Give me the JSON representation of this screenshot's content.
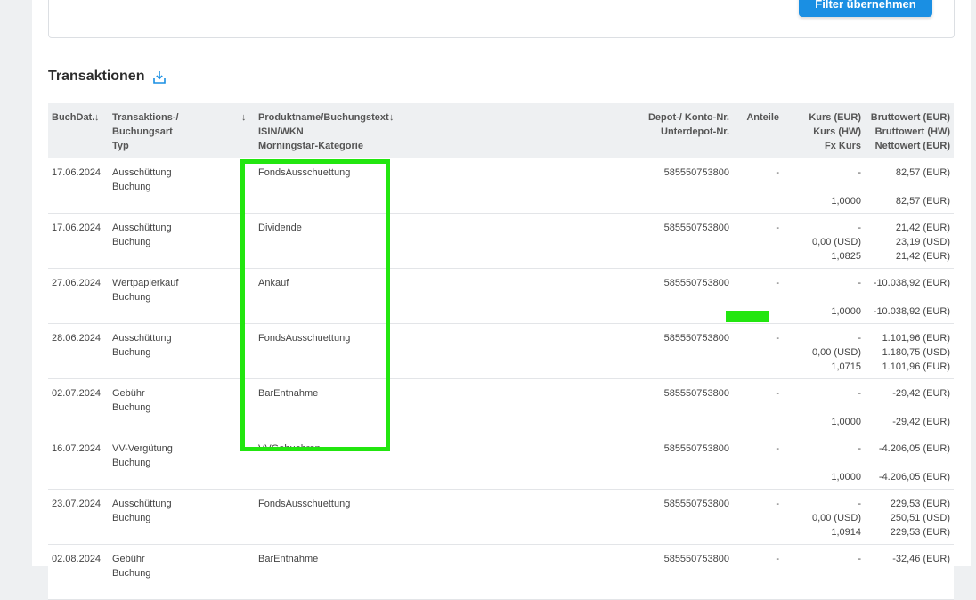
{
  "filter": {
    "apply_label": "Filter übernehmen"
  },
  "section": {
    "title": "Transaktionen",
    "download_icon": "download-icon"
  },
  "header": {
    "date": "BuchDat.",
    "type": [
      "Transaktions-/",
      "Buchungsart",
      "Typ"
    ],
    "product": [
      "Produktname/Buchungstext",
      "ISIN/WKN",
      "Morningstar-Kategorie"
    ],
    "depot": [
      "Depot-/ Konto-Nr.",
      "Unterdepot-Nr."
    ],
    "shares": "Anteile",
    "kurs": [
      "Kurs (EUR)",
      "Kurs (HW)",
      "Fx Kurs"
    ],
    "brutto": [
      "Bruttowert (EUR)",
      "Bruttowert (HW)",
      "Nettowert (EUR)"
    ]
  },
  "rows": [
    {
      "date": "17.06.2024",
      "type1": "Ausschüttung",
      "type2": "Buchung",
      "product": "FondsAusschuettung",
      "depot": "585550753800",
      "shares": "-",
      "kurs": [
        "-",
        "",
        "1,0000"
      ],
      "brutto": [
        "82,57 (EUR)",
        "",
        "82,57 (EUR)"
      ]
    },
    {
      "date": "17.06.2024",
      "type1": "Ausschüttung",
      "type2": "Buchung",
      "product": "Dividende",
      "depot": "585550753800",
      "shares": "-",
      "kurs": [
        "-",
        "0,00 (USD)",
        "1,0825"
      ],
      "brutto": [
        "21,42 (EUR)",
        "23,19 (USD)",
        "21,42 (EUR)"
      ]
    },
    {
      "date": "27.06.2024",
      "type1": "Wertpapierkauf",
      "type2": "Buchung",
      "product": "Ankauf",
      "depot": "585550753800",
      "shares": "-",
      "kurs": [
        "-",
        "",
        "1,0000"
      ],
      "brutto": [
        "-10.038,92 (EUR)",
        "",
        "-10.038,92 (EUR)"
      ]
    },
    {
      "date": "28.06.2024",
      "type1": "Ausschüttung",
      "type2": "Buchung",
      "product": "FondsAusschuettung",
      "depot": "585550753800",
      "shares": "-",
      "kurs": [
        "-",
        "0,00 (USD)",
        "1,0715"
      ],
      "brutto": [
        "1.101,96 (EUR)",
        "1.180,75 (USD)",
        "1.101,96 (EUR)"
      ]
    },
    {
      "date": "02.07.2024",
      "type1": "Gebühr",
      "type2": "Buchung",
      "product": "BarEntnahme",
      "depot": "585550753800",
      "shares": "-",
      "kurs": [
        "-",
        "",
        "1,0000"
      ],
      "brutto": [
        "-29,42 (EUR)",
        "",
        "-29,42 (EUR)"
      ]
    },
    {
      "date": "16.07.2024",
      "type1": "VV-Vergütung",
      "type2": "Buchung",
      "product": "VVGebuehren",
      "depot": "585550753800",
      "shares": "-",
      "kurs": [
        "-",
        "",
        "1,0000"
      ],
      "brutto": [
        "-4.206,05 (EUR)",
        "",
        "-4.206,05 (EUR)"
      ]
    },
    {
      "date": "23.07.2024",
      "type1": "Ausschüttung",
      "type2": "Buchung",
      "product": "FondsAusschuettung",
      "depot": "585550753800",
      "shares": "-",
      "kurs": [
        "-",
        "0,00 (USD)",
        "1,0914"
      ],
      "brutto": [
        "229,53 (EUR)",
        "250,51 (USD)",
        "229,53 (EUR)"
      ]
    },
    {
      "date": "02.08.2024",
      "type1": "Gebühr",
      "type2": "Buchung",
      "product": "BarEntnahme",
      "depot": "585550753800",
      "shares": "-",
      "kurs": [
        "-",
        "",
        ""
      ],
      "brutto": [
        "-32,46 (EUR)",
        "",
        ""
      ]
    }
  ],
  "colors": {
    "accent": "#1a8fe3",
    "highlight": "#22e60f",
    "header_bg": "#eef0f2"
  }
}
